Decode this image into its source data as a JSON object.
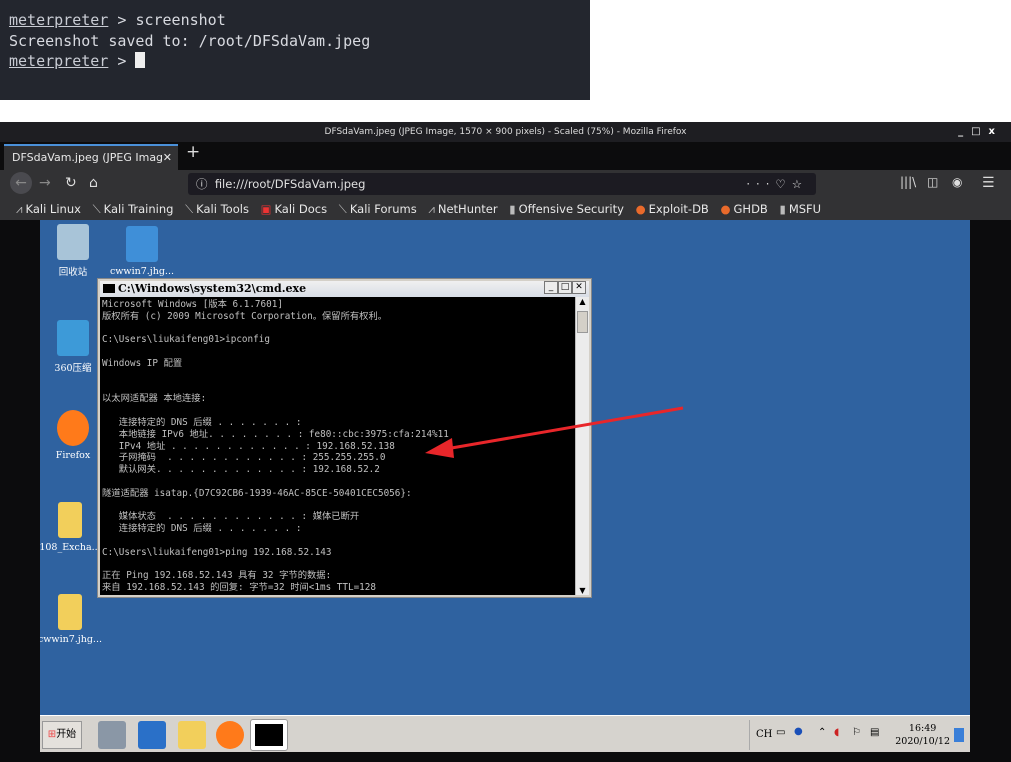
{
  "terminal": {
    "prompt": "meterpreter",
    "lines": [
      {
        "cmd": "screenshot"
      },
      {
        "output": "Screenshot saved to: /root/DFSdaVam.jpeg"
      },
      {
        "cmd": ""
      }
    ]
  },
  "firefox": {
    "window_title": "DFSdaVam.jpeg (JPEG Image, 1570 × 900 pixels) - Scaled (75%) - Mozilla Firefox",
    "tab_label": "DFSdaVam.jpeg (JPEG Imag",
    "url": "file:///root/DFSdaVam.jpeg",
    "bookmarks": [
      "Kali Linux",
      "Kali Training",
      "Kali Tools",
      "Kali Docs",
      "Kali Forums",
      "NetHunter",
      "Offensive Security",
      "Exploit-DB",
      "GHDB",
      "MSFU"
    ]
  },
  "desktop": {
    "icons": [
      {
        "label": "回收站",
        "color": "#a8c4d8"
      },
      {
        "label": "cwwin7.jhg...",
        "color": "#3f8fd8"
      },
      {
        "label": "360压缩",
        "color": "#3d9ad8"
      },
      {
        "label": "Firefox",
        "color": "#ff7a1a"
      },
      {
        "label": "108_Excha...",
        "color": "#f2cf5b"
      },
      {
        "label": "cwwin7.jhg...",
        "color": "#f2cf5b"
      }
    ],
    "background": "#2f62a0"
  },
  "cmd": {
    "title": "C:\\Windows\\system32\\cmd.exe",
    "lines": [
      "Microsoft Windows [版本 6.1.7601]",
      "版权所有 (c) 2009 Microsoft Corporation。保留所有权利。",
      "",
      "C:\\Users\\liukaifeng01>ipconfig",
      "",
      "Windows IP 配置",
      "",
      "",
      "以太网适配器 本地连接:",
      "",
      "   连接特定的 DNS 后缀 . . . . . . . :",
      "   本地链接 IPv6 地址. . . . . . . . : fe80::cbc:3975:cfa:214%11",
      "   IPv4 地址 . . . . . . . . . . . . : 192.168.52.138",
      "   子网掩码  . . . . . . . . . . . . : 255.255.255.0",
      "   默认网关. . . . . . . . . . . . . : 192.168.52.2",
      "",
      "隧道适配器 isatap.{D7C92CB6-1939-46AC-85CE-50401CEC5056}:",
      "",
      "   媒体状态  . . . . . . . . . . . . : 媒体已断开",
      "   连接特定的 DNS 后缀 . . . . . . . :",
      "",
      "C:\\Users\\liukaifeng01>ping 192.168.52.143",
      "",
      "正在 Ping 192.168.52.143 具有 32 字节的数据:",
      "来自 192.168.52.143 的回复: 字节=32 时间<1ms TTL=128"
    ]
  },
  "annotation": {
    "arrow_color": "#e8262a"
  },
  "taskbar": {
    "start_label": "开始",
    "lang": "CH",
    "time": "16:49",
    "date": "2020/10/12"
  }
}
